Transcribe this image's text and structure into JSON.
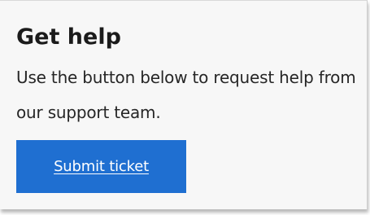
{
  "card": {
    "title": "Get help",
    "description": "Use the button below to request help from our support team.",
    "button_label": "Submit ticket"
  },
  "colors": {
    "card_background": "#f7f7f7",
    "button_background": "#1f6fd1",
    "button_text": "#ffffff",
    "title_text": "#1b1b1b"
  }
}
